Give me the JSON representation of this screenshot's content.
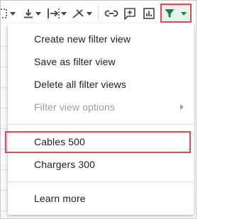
{
  "toolbar": {
    "items": [
      {
        "name": "borders-icon"
      },
      {
        "name": "vertical-align-icon"
      },
      {
        "name": "text-wrapping-icon"
      },
      {
        "name": "text-rotation-icon"
      },
      {
        "name": "insert-link-icon"
      },
      {
        "name": "insert-comment-icon"
      },
      {
        "name": "insert-chart-icon"
      },
      {
        "name": "filter-icon"
      }
    ],
    "filter_color": "#188038",
    "highlight_color": "#e8474f"
  },
  "menu": {
    "items": [
      {
        "label": "Create new filter view"
      },
      {
        "label": "Save as filter view"
      },
      {
        "label": "Delete all filter views"
      },
      {
        "label": "Filter view options",
        "disabled": true,
        "has_submenu": true
      },
      {
        "label": "Cables 500",
        "highlighted": true
      },
      {
        "label": "Chargers 300"
      },
      {
        "label": "Learn more"
      }
    ]
  }
}
